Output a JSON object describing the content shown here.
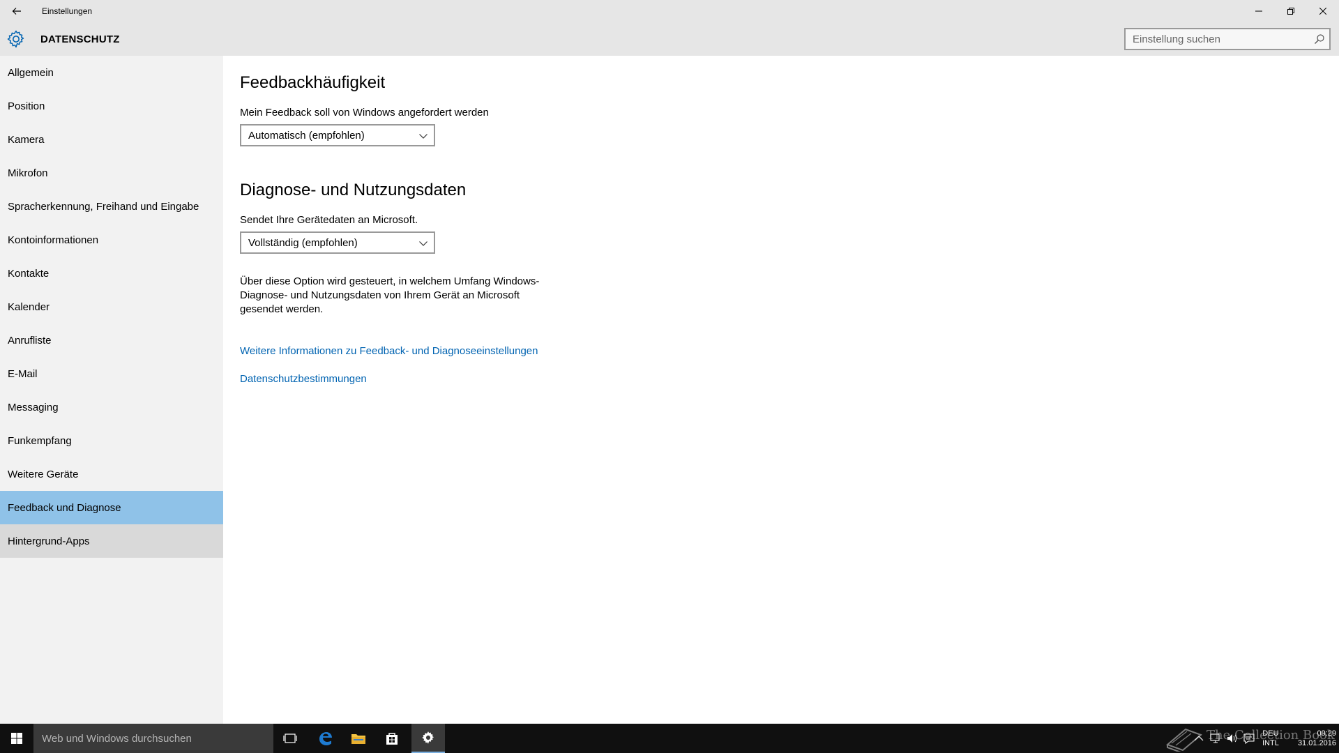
{
  "window": {
    "title": "Einstellungen",
    "controls": {
      "minimize": "minimize",
      "maximize": "restore",
      "close": "close"
    }
  },
  "header": {
    "section_title": "DATENSCHUTZ",
    "search_placeholder": "Einstellung suchen"
  },
  "sidebar": {
    "items": [
      {
        "label": "Allgemein"
      },
      {
        "label": "Position"
      },
      {
        "label": "Kamera"
      },
      {
        "label": "Mikrofon"
      },
      {
        "label": "Spracherkennung, Freihand und Eingabe"
      },
      {
        "label": "Kontoinformationen"
      },
      {
        "label": "Kontakte"
      },
      {
        "label": "Kalender"
      },
      {
        "label": "Anrufliste"
      },
      {
        "label": "E-Mail"
      },
      {
        "label": "Messaging"
      },
      {
        "label": "Funkempfang"
      },
      {
        "label": "Weitere Geräte"
      },
      {
        "label": "Feedback und Diagnose",
        "selected": true
      },
      {
        "label": "Hintergrund-Apps",
        "hover": true
      }
    ]
  },
  "main": {
    "feedback": {
      "heading": "Feedbackhäufigkeit",
      "label": "Mein Feedback soll von Windows angefordert werden",
      "selected_value": "Automatisch (empfohlen)"
    },
    "diagnostics": {
      "heading": "Diagnose- und Nutzungsdaten",
      "label": "Sendet Ihre Gerätedaten an Microsoft.",
      "selected_value": "Vollständig (empfohlen)",
      "description": "Über diese Option wird gesteuert, in welchem Umfang Windows-Diagnose- und Nutzungsdaten von Ihrem Gerät an Microsoft gesendet werden."
    },
    "links": {
      "more_info": "Weitere Informationen zu Feedback- und Diagnoseeinstellungen",
      "privacy": "Datenschutzbestimmungen"
    }
  },
  "taskbar": {
    "search_placeholder": "Web und Windows durchsuchen",
    "language_line1": "DEU",
    "language_line2": "INTL",
    "time": "09:29",
    "date": "31.01.2016",
    "watermark": "The Collection Book"
  },
  "colors": {
    "accent": "#0063b1",
    "selected_nav": "#8fc2e8",
    "titlebar": "#e6e6e6",
    "sidebar": "#f2f2f2",
    "taskbar": "#101010"
  }
}
